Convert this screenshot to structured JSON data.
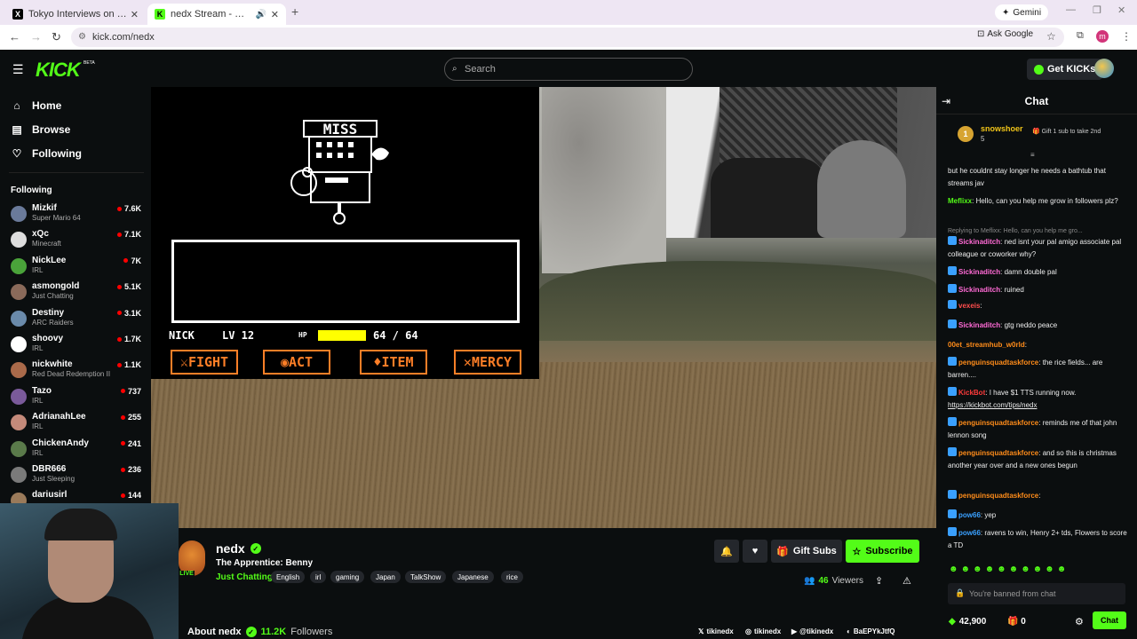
{
  "browser": {
    "tabs": [
      {
        "title": "Tokyo Interviews on X: \"@callin",
        "favicon": "X",
        "active": false
      },
      {
        "title": "nedx Stream - Watch Live o",
        "favicon": "K",
        "active": true
      }
    ],
    "gemini_label": "Gemini",
    "url": "kick.com/nedx",
    "ask_google": "Ask Google",
    "profile_initial": "m"
  },
  "header": {
    "logo": "KICK",
    "logo_badge": "BETA",
    "search_placeholder": "Search",
    "get_kicks": "Get KICKs"
  },
  "sidebar": {
    "nav": [
      {
        "label": "Home",
        "icon": "home-icon"
      },
      {
        "label": "Browse",
        "icon": "browse-icon"
      },
      {
        "label": "Following",
        "icon": "heart-icon"
      }
    ],
    "following_title": "Following",
    "following": [
      {
        "name": "Mizkif",
        "category": "Super Mario 64",
        "viewers": "7.6K",
        "color": "#6a7a9a"
      },
      {
        "name": "xQc",
        "category": "Minecraft",
        "viewers": "7.1K",
        "color": "#dddddd"
      },
      {
        "name": "NickLee",
        "category": "IRL",
        "viewers": "7K",
        "color": "#4aa33a"
      },
      {
        "name": "asmongold",
        "category": "Just Chatting",
        "viewers": "5.1K",
        "color": "#8a6a5a"
      },
      {
        "name": "Destiny",
        "category": "ARC Raiders",
        "viewers": "3.1K",
        "color": "#6a8aaa"
      },
      {
        "name": "shoovy",
        "category": "IRL",
        "viewers": "1.7K",
        "color": "#ffffff"
      },
      {
        "name": "nickwhite",
        "category": "Red Dead Redemption II",
        "viewers": "1.1K",
        "color": "#aa6a4a"
      },
      {
        "name": "Tazo",
        "category": "IRL",
        "viewers": "737",
        "color": "#7a5a9a"
      },
      {
        "name": "AdrianahLee",
        "category": "IRL",
        "viewers": "255",
        "color": "#c48a7a"
      },
      {
        "name": "ChickenAndy",
        "category": "IRL",
        "viewers": "241",
        "color": "#5a7a4a"
      },
      {
        "name": "DBR666",
        "category": "Just Sleeping",
        "viewers": "236",
        "color": "#7a7a7a"
      },
      {
        "name": "dariusirl",
        "category": "",
        "viewers": "144",
        "color": "#9a7a5a"
      }
    ]
  },
  "game": {
    "boss_text": "MISS",
    "hud_name": "NICK",
    "hud_lv": "LV 12",
    "hud_hp_label": "HP",
    "hud_hp_value": "64 / 64",
    "hp_fraction": 1.0,
    "buttons": [
      "FIGHT",
      "ACT",
      "ITEM",
      "MERCY"
    ],
    "button_color": "#ff7f27"
  },
  "stream": {
    "name": "nedx",
    "title": "The Apprentice: Benny",
    "category": "Just Chatting",
    "tags": [
      "English",
      "irl",
      "gaming",
      "Japan",
      "TalkShow",
      "Japanese",
      "rice"
    ],
    "live_label": "LIVE",
    "gift_subs": "Gift Subs",
    "subscribe": "Subscribe",
    "viewers_count": "46",
    "viewers_label": "Viewers",
    "about_label": "About nedx",
    "followers_count": "11.2K",
    "followers_label": "Followers",
    "socials": [
      {
        "icon": "x-icon",
        "label": "tikinedx"
      },
      {
        "icon": "instagram-icon",
        "label": "tikinedx"
      },
      {
        "icon": "youtube-icon",
        "label": "@tikinedx"
      },
      {
        "icon": "discord-icon",
        "label": "BaEPYkJtfQ"
      }
    ]
  },
  "chat": {
    "title": "Chat",
    "pinned": {
      "badge": "1",
      "user": "snowshoer",
      "count": "5",
      "message": "Gift 1 sub to take 2nd"
    },
    "messages": [
      {
        "user": "",
        "color": "#ffffff",
        "text": "but he couldnt stay longer he needs a bathtub that streams jav"
      },
      {
        "user": "Meflixx",
        "color": "#53fc18",
        "text": "Hello, can you help me grow in followers plz?"
      },
      {
        "reply": "Replying to Meflixx: Hello, can you help me gro..."
      },
      {
        "user": "Sickinaditch",
        "color": "#ff6ad5",
        "text": "ned isnt your pal amigo associate pal colleague or coworker why?"
      },
      {
        "user": "Sickinaditch",
        "color": "#ff6ad5",
        "text": "damn double pal"
      },
      {
        "user": "Sickinaditch",
        "color": "#ff6ad5",
        "text": "ruined"
      },
      {
        "user": "vexeis",
        "color": "#ff4d4d",
        "text": ""
      },
      {
        "user": "Sickinaditch",
        "color": "#ff6ad5",
        "text": "gtg neddo peace"
      },
      {
        "user": "00et_streamhub_w0rld",
        "color": "#ff8c1a",
        "text": ""
      },
      {
        "user": "penguinsquadtaskforce",
        "color": "#ff8c1a",
        "text": "the rice fields... are barren...."
      },
      {
        "user": "KickBot",
        "color": "#ff3b3b",
        "text": "I have $1 TTS running now.",
        "link": "https://kickbot.com/tips/nedx"
      },
      {
        "user": "penguinsquadtaskforce",
        "color": "#ff8c1a",
        "text": "reminds me of that john lennon song"
      },
      {
        "user": "penguinsquadtaskforce",
        "color": "#ff8c1a",
        "text": "and so this is christmas another year over and a new ones begun"
      },
      {
        "user": "penguinsquadtaskforce",
        "color": "#ff8c1a",
        "text": ""
      },
      {
        "user": "pow66",
        "color": "#3aa0ff",
        "text": "yep"
      },
      {
        "user": "pow66",
        "color": "#3aa0ff",
        "text": "ravens to win, Henry 2+ tds, Flowers to score a TD"
      }
    ],
    "banned_text": "You're banned from chat",
    "points": "42,900",
    "gifts": "0",
    "chat_button": "Chat"
  }
}
